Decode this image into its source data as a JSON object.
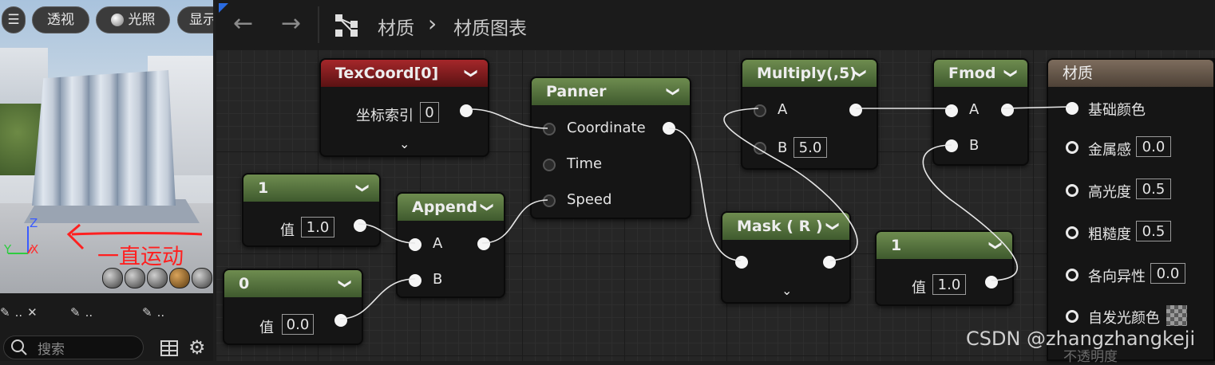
{
  "viewport": {
    "menu_icon": "hamburger-icon",
    "buttons": [
      "透视",
      "光照",
      "显示"
    ],
    "axis": {
      "z": "Z",
      "y": "Y",
      "x": "X"
    },
    "annotation": "一直运动"
  },
  "left_tabs": [
    {
      "label": "..",
      "icon": "pencil-icon",
      "close": "✕"
    },
    {
      "label": "..",
      "icon": "pencil-icon"
    },
    {
      "label": "..",
      "icon": "pencil-icon"
    }
  ],
  "search": {
    "placeholder": "搜索"
  },
  "breadcrumb": {
    "root": "材质",
    "separator": "›",
    "current": "材质图表"
  },
  "nodes": {
    "texcoord": {
      "title": "TexCoord[0]",
      "label": "坐标索引",
      "value": "0"
    },
    "panner": {
      "title": "Panner",
      "pins": [
        "Coordinate",
        "Time",
        "Speed"
      ]
    },
    "const1": {
      "title": "1",
      "label": "值",
      "value": "1.0"
    },
    "append": {
      "title": "Append",
      "pins": [
        "A",
        "B"
      ]
    },
    "const0": {
      "title": "0",
      "label": "值",
      "value": "0.0"
    },
    "multiply": {
      "title": "Multiply(,5)",
      "pins": [
        "A",
        "B"
      ],
      "b_value": "5.0"
    },
    "mask": {
      "title": "Mask ( R )"
    },
    "const1b": {
      "title": "1",
      "label": "值",
      "value": "1.0"
    },
    "fmod": {
      "title": "Fmod",
      "pins": [
        "A",
        "B"
      ]
    },
    "material": {
      "title": "材质",
      "rows": [
        {
          "label": "基础颜色",
          "value": ""
        },
        {
          "label": "金属感",
          "value": "0.0"
        },
        {
          "label": "高光度",
          "value": "0.5"
        },
        {
          "label": "粗糙度",
          "value": "0.5"
        },
        {
          "label": "各向异性",
          "value": "0.0"
        },
        {
          "label": "自发光颜色",
          "value": ""
        }
      ],
      "faded_row": "不透明度"
    }
  },
  "watermark": "CSDN @zhangzhangkeji"
}
